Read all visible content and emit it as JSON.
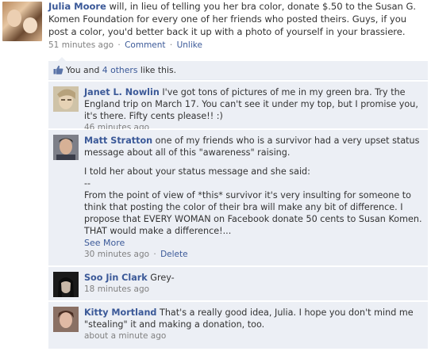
{
  "post": {
    "author": "Julia Moore",
    "text": " will, in lieu of telling you her bra color, donate $.50 to the Susan G. Komen Foundation for every one of her friends who posted theirs. Guys, if you post a color, you'd better back it up with a photo of yourself in your brassiere.",
    "timestamp": "51 minutes ago",
    "comment_link": "Comment",
    "unlike_link": "Unlike",
    "separator": "·"
  },
  "likes": {
    "prefix": "You and ",
    "others_link": "4 others",
    "suffix": " like this."
  },
  "comments": [
    {
      "author": "Janet L. Nowlin",
      "text": " I've got tons of pictures of me in my green bra. Try the England trip on March 17. You can't see it under my top, but I promise you, it's there. Fifty cents please!! :)",
      "timestamp": "46 minutes ago"
    },
    {
      "author": "Matt Stratton",
      "text": " one of my friends who is a survivor had a very upset status message about all of this \"awareness\" raising.",
      "para2": "I told her about your status message and she said:",
      "para3": "--",
      "para4": "From the point of view of *this* survivor it's very insulting for someone to think that posting the color of their bra will make any bit of difference. I propose that EVERY WOMAN on Facebook donate 50 cents to Susan Komen. THAT would make a difference!...",
      "see_more": "See More",
      "timestamp": "30 minutes ago",
      "separator": "·",
      "delete_link": "Delete"
    },
    {
      "author": "Soo Jin Clark",
      "text": " Grey-",
      "timestamp": "18 minutes ago"
    },
    {
      "author": "Kitty Mortland",
      "text": " That's a really good idea, Julia. I hope you don't mind me \"stealing\" it and making a donation, too.",
      "timestamp": "about a minute ago"
    }
  ],
  "colors": {
    "link": "#3b5998",
    "feedback_bg": "#eceff5",
    "meta_text": "#808080"
  }
}
